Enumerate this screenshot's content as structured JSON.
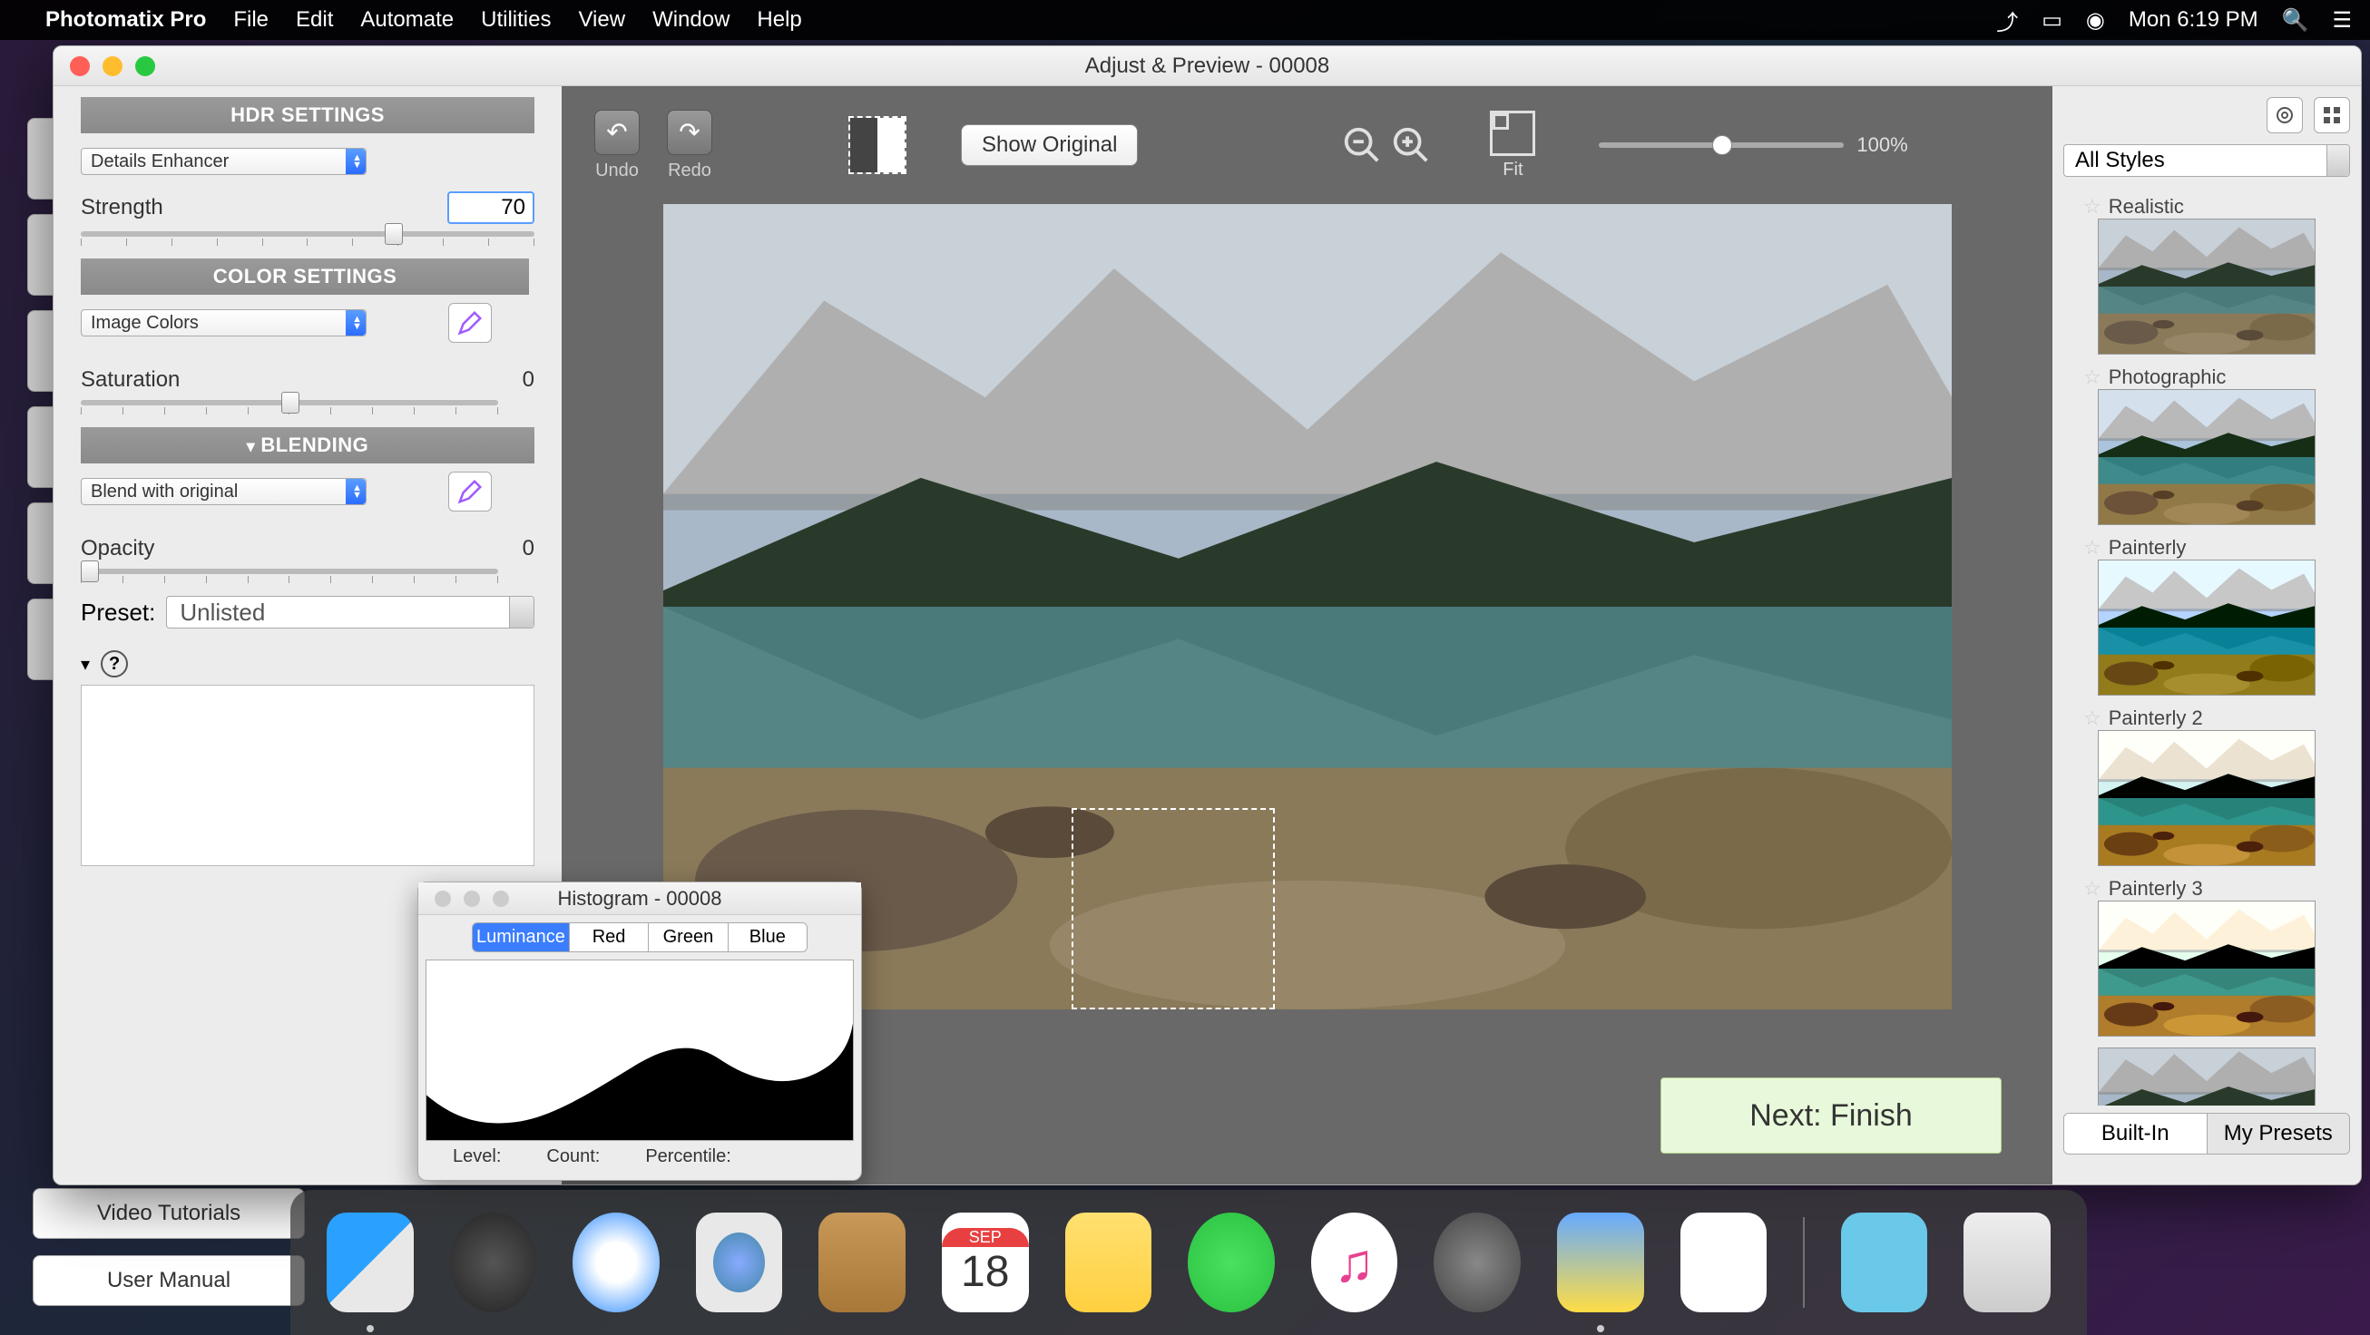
{
  "menubar": {
    "app_name": "Photomatix Pro",
    "items": [
      "File",
      "Edit",
      "Automate",
      "Utilities",
      "View",
      "Window",
      "Help"
    ],
    "clock": "Mon 6:19 PM"
  },
  "window": {
    "title": "Adjust & Preview - 00008"
  },
  "left": {
    "hdr_header": "HDR SETTINGS",
    "hdr_dropdown": "Details Enhancer",
    "strength_label": "Strength",
    "strength_value": "70",
    "color_header": "COLOR SETTINGS",
    "color_dropdown": "Image Colors",
    "saturation_label": "Saturation",
    "saturation_value": "0",
    "blend_header": "BLENDING",
    "blend_dropdown": "Blend with original",
    "opacity_label": "Opacity",
    "opacity_value": "0",
    "preset_label": "Preset:",
    "preset_value": "Unlisted"
  },
  "toolbar": {
    "undo": "Undo",
    "redo": "Redo",
    "show_original": "Show Original",
    "fit": "Fit",
    "zoom_value": "100%"
  },
  "next_button": "Next: Finish",
  "right": {
    "style_dropdown": "All Styles",
    "presets": [
      {
        "name": "Realistic"
      },
      {
        "name": "Photographic"
      },
      {
        "name": "Painterly"
      },
      {
        "name": "Painterly 2"
      },
      {
        "name": "Painterly 3"
      }
    ],
    "tabs": {
      "builtin": "Built-In",
      "mypresets": "My Presets"
    }
  },
  "histogram": {
    "title": "Histogram - 00008",
    "tabs": [
      "Luminance",
      "Red",
      "Green",
      "Blue"
    ],
    "level": "Level:",
    "count": "Count:",
    "percentile": "Percentile:"
  },
  "bottom_buttons": {
    "tutorials": "Video Tutorials",
    "manual": "User Manual"
  }
}
